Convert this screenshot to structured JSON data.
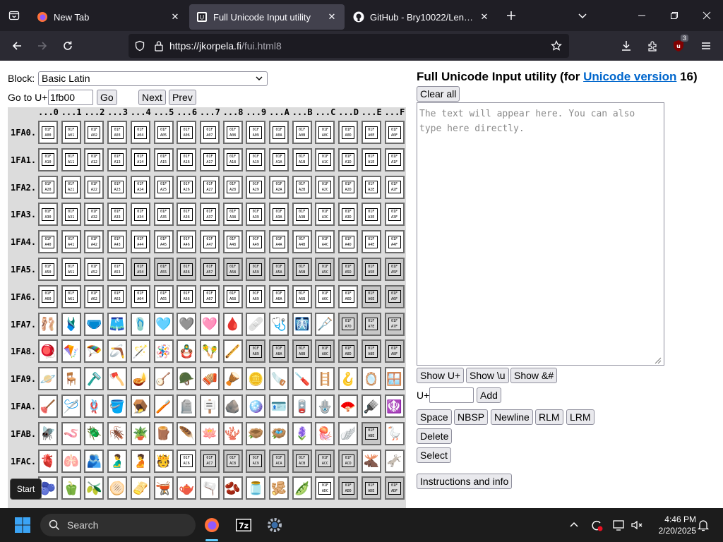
{
  "browser": {
    "tabs": [
      {
        "title": "New Tab",
        "active": false
      },
      {
        "title": "Full Unicode Input utility",
        "active": true
      },
      {
        "title": "GitHub - Bry10022/Lentariso: Th",
        "active": false
      }
    ],
    "url_host": "https://jkorpela.fi",
    "url_path": "/fui.html8",
    "extension_badge": "3"
  },
  "controls": {
    "block_label": "Block:",
    "block_selected": "Basic Latin",
    "goto_label": "Go to U+",
    "goto_value": "1fb00",
    "go_button": "Go",
    "next_button": "Next",
    "prev_button": "Prev"
  },
  "grid": {
    "col_headers": [
      "...0",
      "...1",
      "...2",
      "...3",
      "...4",
      "...5",
      "...6",
      "...7",
      "...8",
      "...9",
      "...A",
      "...B",
      "...C",
      "...D",
      "...E",
      "...F"
    ],
    "rows": [
      {
        "label": "1FA0.",
        "prefix": "1FA0",
        "cells": [
          "H",
          "H",
          "H",
          "H",
          "H",
          "H",
          "H",
          "H",
          "H",
          "H",
          "H",
          "H",
          "H",
          "H",
          "H",
          "H"
        ]
      },
      {
        "label": "1FA1.",
        "prefix": "1FA1",
        "cells": [
          "H",
          "H",
          "H",
          "H",
          "H",
          "H",
          "H",
          "H",
          "H",
          "H",
          "H",
          "H",
          "H",
          "H",
          "H",
          "H"
        ]
      },
      {
        "label": "1FA2.",
        "prefix": "1FA2",
        "cells": [
          "H",
          "H",
          "H",
          "H",
          "H",
          "H",
          "H",
          "H",
          "H",
          "H",
          "H",
          "H",
          "H",
          "H",
          "H",
          "H"
        ]
      },
      {
        "label": "1FA3.",
        "prefix": "1FA3",
        "cells": [
          "H",
          "H",
          "H",
          "H",
          "H",
          "H",
          "H",
          "H",
          "H",
          "H",
          "H",
          "H",
          "H",
          "H",
          "H",
          "H"
        ]
      },
      {
        "label": "1FA4.",
        "prefix": "1FA4",
        "cells": [
          "H",
          "H",
          "H",
          "H",
          "H",
          "H",
          "H",
          "H",
          "H",
          "H",
          "H",
          "H",
          "H",
          "H",
          "H",
          "H"
        ]
      },
      {
        "label": "1FA5.",
        "prefix": "1FA5",
        "cells": [
          "H",
          "H",
          "H",
          "H",
          "U",
          "U",
          "U",
          "U",
          "U",
          "U",
          "U",
          "U",
          "U",
          "U",
          "U",
          "U"
        ]
      },
      {
        "label": "1FA6.",
        "prefix": "1FA6",
        "cells": [
          "H",
          "H",
          "H",
          "H",
          "H",
          "H",
          "H",
          "H",
          "H",
          "H",
          "H",
          "H",
          "H",
          "H",
          "U",
          "U"
        ]
      },
      {
        "label": "1FA7.",
        "prefix": "1FA7",
        "cells": [
          "🩰",
          "🩱",
          "🩲",
          "🩳",
          "🩴",
          "🩵",
          "🩶",
          "🩷",
          "🩸",
          "🩹",
          "🩺",
          "🩻",
          "🩼",
          "U",
          "U",
          "U"
        ]
      },
      {
        "label": "1FA8.",
        "prefix": "1FA8",
        "cells": [
          "🪀",
          "🪁",
          "🪂",
          "🪃",
          "🪄",
          "🪅",
          "🪆",
          "🪇",
          "🪈",
          "U",
          "U",
          "U",
          "U",
          "U",
          "U",
          "U"
        ]
      },
      {
        "label": "1FA9.",
        "prefix": "1FA9",
        "cells": [
          "🪐",
          "🪑",
          "🪒",
          "🪓",
          "🪔",
          "🪕",
          "🪖",
          "🪗",
          "🪘",
          "🪙",
          "🪚",
          "🪛",
          "🪜",
          "🪝",
          "🪞",
          "🪟"
        ]
      },
      {
        "label": "1FAA.",
        "prefix": "1FAA",
        "cells": [
          "🪠",
          "🪡",
          "🪢",
          "🪣",
          "🪤",
          "🪥",
          "🪦",
          "🪧",
          "🪨",
          "🪩",
          "🪪",
          "🪫",
          "🪬",
          "🪭",
          "🪮",
          "🪯"
        ]
      },
      {
        "label": "1FAB.",
        "prefix": "1FAB",
        "cells": [
          "🪰",
          "🪱",
          "🪲",
          "🪳",
          "🪴",
          "🪵",
          "🪶",
          "🪷",
          "🪸",
          "🪹",
          "🪺",
          "🪻",
          "🪼",
          "🪽",
          "U",
          "🪿"
        ]
      },
      {
        "label": "1FAC.",
        "prefix": "1FAC",
        "cells": [
          "🫀",
          "🫁",
          "🫂",
          "🫃",
          "🫄",
          "🫅",
          "H",
          "U",
          "U",
          "U",
          "U",
          "U",
          "U",
          "U",
          "🫎",
          "🫏"
        ]
      },
      {
        "label": "1FAD.",
        "prefix": "1FAD",
        "cells": [
          "🫐",
          "🫑",
          "🫒",
          "🫓",
          "🫔",
          "🫕",
          "🫖",
          "🫗",
          "🫘",
          "🫙",
          "🫚",
          "🫛",
          "H",
          "U",
          "U",
          "U"
        ]
      }
    ]
  },
  "right": {
    "title_prefix": "Full Unicode Input utility (for ",
    "title_link": "Unicode version",
    "title_suffix": " 16)",
    "clear_all": "Clear all",
    "textarea_placeholder": "The text will appear here. You can also type here directly.",
    "show_uplus": "Show U+",
    "show_u": "Show \\u",
    "show_amp": "Show &#",
    "uplus_label": "U+",
    "add_button": "Add",
    "space": "Space",
    "nbsp": "NBSP",
    "newline": "Newline",
    "rlm": "RLM",
    "lrm": "LRM",
    "delete": "Delete",
    "select": "Select",
    "instructions": "Instructions and info"
  },
  "taskbar": {
    "start_tooltip": "Start",
    "search_label": "Search",
    "time": "4:46 PM",
    "date": "2/20/2025"
  }
}
